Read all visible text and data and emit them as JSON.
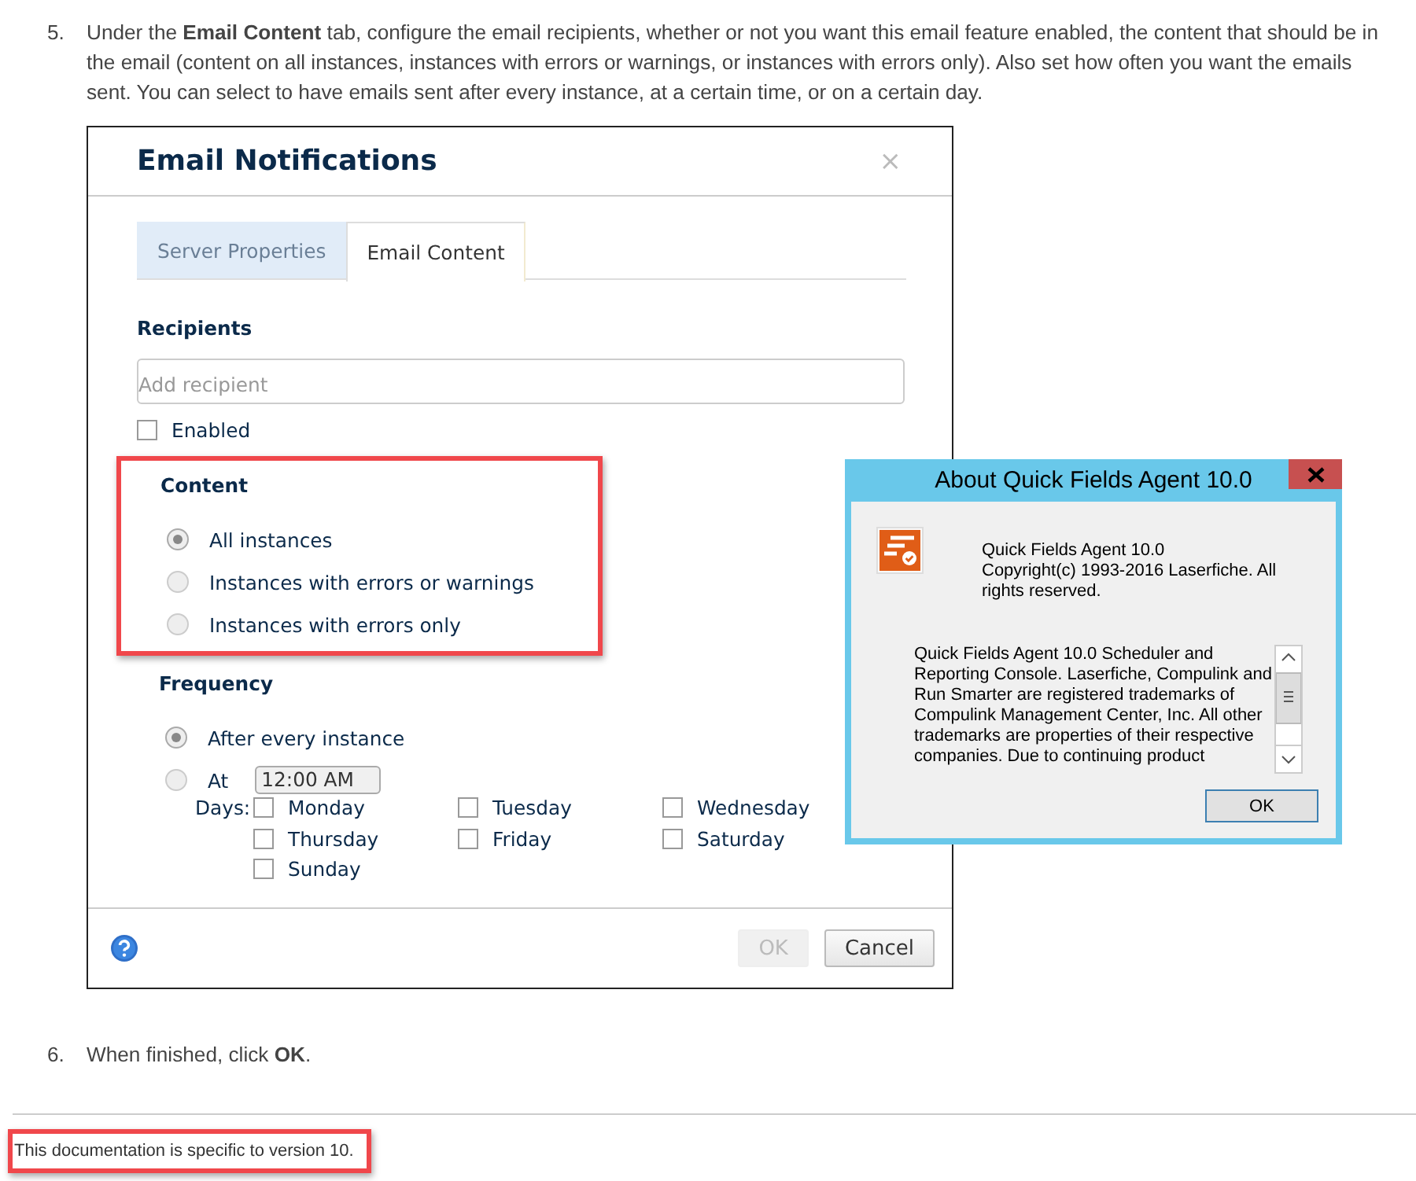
{
  "step_5": {
    "number": "5.",
    "text": "Under the **Email Content** tab, configure the email recipients, whether or not you want this email feature enabled, the content that should be in the email (content on all instances, instances with errors or warnings, or instances with errors only). Also set how often you want the emails sent. You can select to have emails sent after every instance, at a certain time, or on a certain day."
  },
  "email_dialog": {
    "title": "Email Notifications",
    "close": "×",
    "tabs": [
      {
        "label": "Server Properties",
        "selected": false
      },
      {
        "label": "Email Content",
        "selected": true
      }
    ],
    "recipients": {
      "heading": "Recipients",
      "placeholder": "Add recipient"
    },
    "enabled": {
      "label": "Enabled",
      "checked": false
    },
    "content": {
      "heading": "Content",
      "highlighted": true,
      "options": [
        {
          "label": "All instances",
          "selected": true
        },
        {
          "label": "Instances with errors or warnings",
          "selected": false
        },
        {
          "label": "Instances with errors only",
          "selected": false
        }
      ]
    },
    "frequency": {
      "heading": "Frequency",
      "options": [
        {
          "label": "After every instance",
          "selected": true
        },
        {
          "label": "At",
          "selected": false
        }
      ],
      "time": "12:00 AM",
      "days_label": "Days:",
      "days": [
        {
          "label": "Monday",
          "checked": false
        },
        {
          "label": "Tuesday",
          "checked": false
        },
        {
          "label": "Wednesday",
          "checked": false
        },
        {
          "label": "Thursday",
          "checked": false
        },
        {
          "label": "Friday",
          "checked": false
        },
        {
          "label": "Saturday",
          "checked": false
        },
        {
          "label": "Sunday",
          "checked": false
        }
      ]
    },
    "buttons": [
      {
        "label": "OK",
        "disabled": true
      },
      {
        "label": "Cancel",
        "disabled": false
      }
    ]
  },
  "about_window": {
    "title": "About Quick Fields Agent 10.0",
    "product": "Quick Fields Agent 10.0",
    "copyright": "Copyright(c) 1993-2016 Laserfiche. All rights reserved.",
    "description": "Quick Fields Agent 10.0 Scheduler and Reporting Console.  Laserfiche, Compulink and Run Smarter are registered trademarks of Compulink Management Center, Inc. All other trademarks are properties of their respective companies. Due to continuing product",
    "ok": "OK"
  },
  "step_6": {
    "number": "6.",
    "text": "When finished, click **OK**."
  },
  "footer": {
    "text": "This documentation is specific to version 10.",
    "highlighted": true
  }
}
